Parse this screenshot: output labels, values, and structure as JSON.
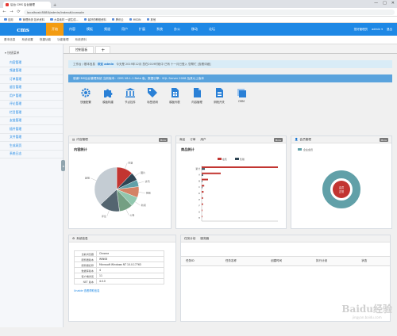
{
  "browser": {
    "tab_title": "后台 CMS 后台管理",
    "newtab": "+",
    "winctl": [
      "—",
      "□",
      "✕"
    ],
    "url": "localhost:8080/admin/index#/console",
    "nav": [
      "←",
      "→",
      "⟳"
    ],
    "bookmarks": [
      "应用",
      "管理系统 技术资料",
      "大量素材 一键生成...",
      "最好的教程资料",
      "腾讯云",
      "MSDN",
      "其他"
    ]
  },
  "topbar": {
    "logo": "cms",
    "nav": [
      "开始",
      "内容",
      "模板",
      "频道",
      "用户",
      "扩展",
      "系统",
      "办公",
      "移动",
      "论坛"
    ],
    "active_index": 0,
    "user_label": "您好管理员",
    "user_name": "admin ▾",
    "logout": "退出"
  },
  "subnav": [
    "基本信息",
    "系统设置",
    "快捷功能",
    "功能管理",
    "系统资料"
  ],
  "sidebar": {
    "group": "▾ 快捷菜单",
    "items": [
      "内容管理",
      "频道管理",
      "订单管理",
      "留言管理",
      "用户管理",
      "评论管理",
      "栏目管理",
      "友链管理",
      "插件管理",
      "文件管理",
      "生成网页",
      "系统日志"
    ],
    "collapse": "◂"
  },
  "page_tabs": [
    "控制面板",
    "+"
  ],
  "notice": {
    "prefix": "工作台 / 基本信息",
    "welcome": "欢迎 admin",
    "text": "今天是 2019年12月 您在2019时段中 已有 十一月已登入 您帮忙 [查看详细]"
  },
  "infobar": "感谢CMS后台管理系统 当前版本：CMS V8.1.1 Beta 版，数据引擎：SQL Server 2008 及其以上版本",
  "shortcuts": [
    {
      "label": "快速配置",
      "icon": "gear-icon"
    },
    {
      "label": "模板构建",
      "icon": "puzzle-icon"
    },
    {
      "label": "节点控件",
      "icon": "bank-icon"
    },
    {
      "label": "标签说明",
      "icon": "tag-icon"
    },
    {
      "label": "模板列表",
      "icon": "file-grid-icon"
    },
    {
      "label": "内容管理",
      "icon": "file-icon"
    },
    {
      "label": "阴阳开关",
      "icon": "file-lines-icon"
    },
    {
      "label": "ORM",
      "icon": "layers-icon"
    }
  ],
  "panels": {
    "content": {
      "head": "内容管理",
      "more": "More",
      "title": "内容统计"
    },
    "goods": {
      "head_items": [
        "商品",
        "订单",
        "用户"
      ],
      "more": "More",
      "title": "商品统计"
    },
    "users": {
      "head": "会员管理",
      "more": "More"
    },
    "system": {
      "head": "系统信息"
    },
    "tasks": {
      "head_items": [
        "任务计划",
        "服务器"
      ],
      "columns": [
        "任务ID",
        "任务名称",
        "创建时间",
        "执行计划",
        "状态"
      ]
    }
  },
  "system_info": {
    "rows": [
      [
        "当前浏览器",
        "Chrome"
      ],
      [
        "服务器版本",
        "WIN08"
      ],
      [
        "服务器名称",
        "Microsoft Windows NT 10.0.17763"
      ],
      [
        "数据库版本",
        "4"
      ],
      [
        "客户端浏览",
        "11"
      ],
      [
        "NET 版本",
        "4.0.0"
      ]
    ],
    "note": "Unable 查看帮助信息"
  },
  "chart_data": [
    {
      "type": "pie",
      "title": "内容统计",
      "labels": [
        "内容",
        "图片",
        "资讯",
        "视频",
        "新闻",
        "公告",
        "评论",
        "其他"
      ],
      "values": [
        12,
        6,
        5,
        8,
        7,
        10,
        15,
        37
      ],
      "colors": [
        "#c23531",
        "#2f4554",
        "#61a0a8",
        "#d48265",
        "#91c7ae",
        "#749f83",
        "#546570",
        "#c4ccd3"
      ]
    },
    {
      "type": "bar",
      "title": "商品统计",
      "legend": [
        "在售",
        "售罄"
      ],
      "categories": [
        "累计",
        "A",
        "B",
        "C",
        "D",
        "E",
        "F",
        "G",
        "H"
      ],
      "series": [
        {
          "name": "在售",
          "values": [
            120,
            30,
            10,
            4,
            3,
            2,
            2,
            1,
            1
          ],
          "color": "#c23531"
        },
        {
          "name": "售罄",
          "values": [
            5,
            2,
            1,
            1,
            0,
            0,
            0,
            0,
            0
          ],
          "color": "#2f4554"
        }
      ],
      "xlim": [
        0,
        120
      ]
    },
    {
      "type": "pie",
      "legend": [
        "企业会员"
      ],
      "labels": [
        "会员",
        "正常"
      ],
      "values": [
        85,
        15
      ],
      "colors": [
        "#61a0a8",
        "#c23531"
      ]
    }
  ],
  "watermark": {
    "brand": "Baidu经验",
    "sub": "jingyan.baidu.com"
  }
}
